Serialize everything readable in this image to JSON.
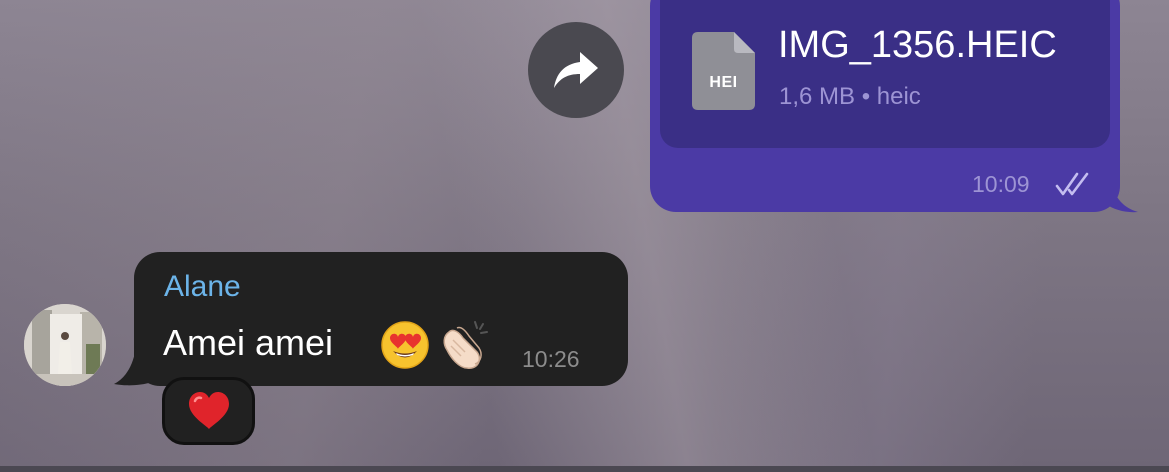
{
  "outgoing_message": {
    "file_name": "IMG_1356.HEIC",
    "file_type_badge": "HEI",
    "file_meta": "1,6 MB • heic",
    "time": "10:09",
    "status_icon": "double-check-icon"
  },
  "forward_button": {
    "icon": "forward-arrow-icon"
  },
  "incoming_message": {
    "sender": "Alane",
    "text": "Amei amei",
    "emojis": [
      "heart-eyes-emoji",
      "clapping-hands-emoji"
    ],
    "time": "10:26",
    "reaction": {
      "emoji": "red-heart-emoji"
    }
  },
  "colors": {
    "outgoing_bubble": "#4b3aa5",
    "file_card": "#3a2f86",
    "incoming_bubble": "#212121",
    "sender_name": "#6cb4e9"
  }
}
